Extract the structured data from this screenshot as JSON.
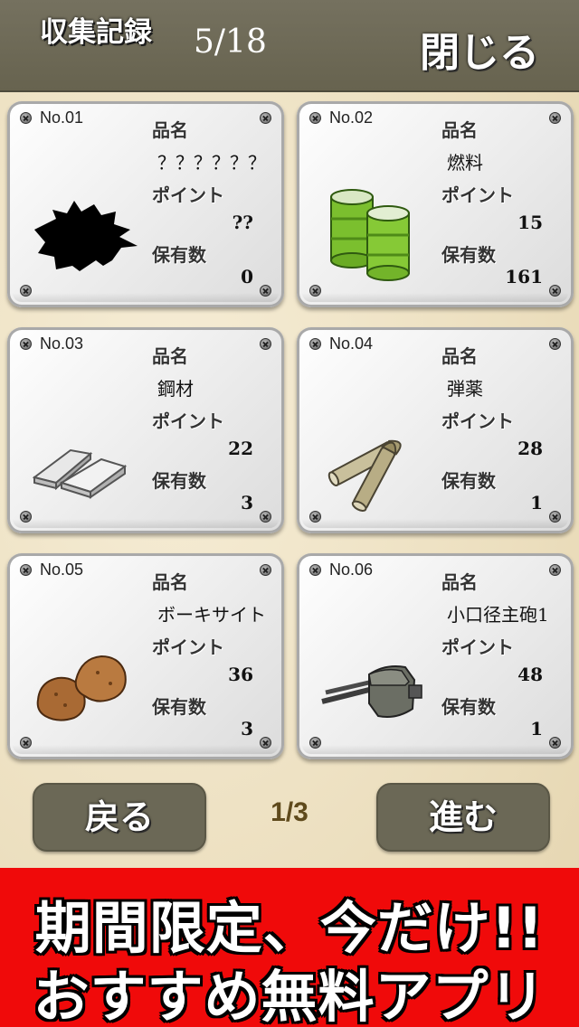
{
  "header": {
    "title": "収集記録",
    "count": "5/18",
    "close_label": "閉じる"
  },
  "labels": {
    "name": "品名",
    "point": "ポイント",
    "owned": "保有数"
  },
  "items": [
    {
      "number": "No.01",
      "name": "？？？？？？",
      "point": "??",
      "owned": "0",
      "icon": "unknown-silhouette"
    },
    {
      "number": "No.02",
      "name": "燃料",
      "point": "15",
      "owned": "161",
      "icon": "fuel-drums"
    },
    {
      "number": "No.03",
      "name": "鋼材",
      "point": "22",
      "owned": "3",
      "icon": "steel-ingots"
    },
    {
      "number": "No.04",
      "name": "弾薬",
      "point": "28",
      "owned": "1",
      "icon": "ammo-shells"
    },
    {
      "number": "No.05",
      "name": "ボーキサイト",
      "point": "36",
      "owned": "3",
      "icon": "bauxite-rocks"
    },
    {
      "number": "No.06",
      "name": "小口径主砲1",
      "point": "48",
      "owned": "1",
      "icon": "naval-gun-turret"
    }
  ],
  "pager": {
    "back_label": "戻る",
    "page": "1/3",
    "next_label": "進む"
  },
  "banner": {
    "line1": "期間限定、今だけ!!",
    "line2": "おすすめ無料アプリ"
  }
}
